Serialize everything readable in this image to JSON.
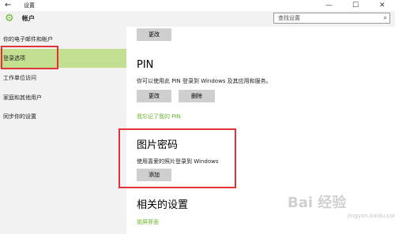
{
  "titlebar": {
    "back_icon": "back-arrow-icon",
    "title": "设置",
    "minimize": "—",
    "maximize": "☐",
    "close": "✕"
  },
  "header": {
    "icon": "gear-icon",
    "title": "帐户"
  },
  "search": {
    "placeholder": "查找设置",
    "icon": "search-icon"
  },
  "sidebar": {
    "items": [
      {
        "label": "你的电子邮件和帐户"
      },
      {
        "label": "登录选项",
        "active": true
      },
      {
        "label": "工作单位访问"
      },
      {
        "label": "家庭和其他用户"
      },
      {
        "label": "同步你的设置"
      }
    ]
  },
  "main": {
    "top_change_label": "更改",
    "pin": {
      "heading": "PIN",
      "description": "你可以使用此 PIN 登录到 Windows 及其应用和服务。",
      "change_label": "更改",
      "remove_label": "删除",
      "forgot_link": "我忘记了我的 PIN"
    },
    "picture_password": {
      "heading": "图片密码",
      "description": "使用喜爱的照片登录到 Windows",
      "add_label": "添加"
    },
    "related": {
      "heading": "相关的设置",
      "link": "锁屏界面"
    }
  },
  "watermark": {
    "main": "Bai 经验",
    "sub": "jingyan.baidu.com"
  },
  "colors": {
    "accent_green": "#6cb52d",
    "active_item": "#c3e091",
    "highlight_red": "#e1323a"
  }
}
